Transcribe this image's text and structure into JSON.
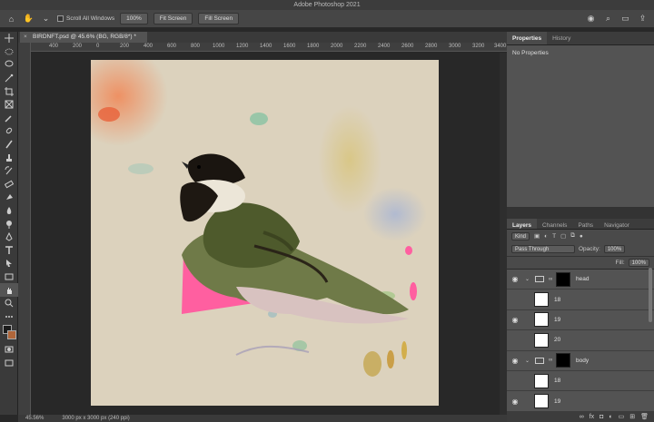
{
  "window": {
    "title": "Adobe Photoshop 2021"
  },
  "options_bar": {
    "scroll_all_windows": "Scroll All Windows",
    "zoom_100": "100%",
    "fit_screen": "Fit Screen",
    "fill_screen": "Fill Screen"
  },
  "document": {
    "tab_title": "BIRDNFT.psd @ 45.6% (BG, RGB/8*) *",
    "ruler_h": [
      "400",
      "200",
      "0",
      "200",
      "400",
      "600",
      "800",
      "1000",
      "1200",
      "1400",
      "1600",
      "1800",
      "2000",
      "2200",
      "2400",
      "2600",
      "2800",
      "3000",
      "3200",
      "3400"
    ]
  },
  "status": {
    "zoom": "45.56%",
    "doc_size": "3000 px x 3000 px (240 ppi)"
  },
  "panels": {
    "top_tabs": [
      "Properties",
      "History"
    ],
    "properties_empty": "No Properties",
    "layer_tabs": [
      "Layers",
      "Channels",
      "Paths",
      "Navigator"
    ],
    "filter_kind": "Kind",
    "blend_mode": "Pass Through",
    "opacity_label": "Opacity:",
    "opacity_value": "100%",
    "fill_label": "Fill:",
    "fill_value": "100%"
  },
  "layers": [
    {
      "name": "head",
      "type": "group",
      "visible": true
    },
    {
      "name": "18",
      "type": "layer",
      "visible": false
    },
    {
      "name": "19",
      "type": "layer",
      "visible": true
    },
    {
      "name": "20",
      "type": "layer",
      "visible": false
    },
    {
      "name": "body",
      "type": "group",
      "visible": true
    },
    {
      "name": "18",
      "type": "layer",
      "visible": false
    },
    {
      "name": "19",
      "type": "layer",
      "visible": true
    }
  ],
  "colors": {
    "accent_pink": "#ff5fa0",
    "paper": "#dcd2bd"
  }
}
